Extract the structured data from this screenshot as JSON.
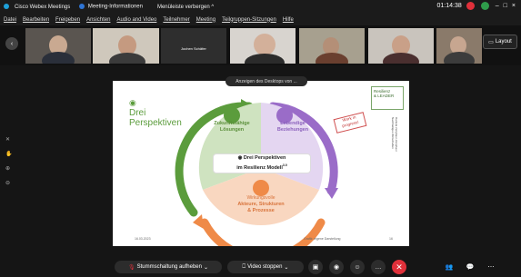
{
  "window": {
    "app_title": "Cisco Webex Meetings",
    "meeting_info": "Meeting-Informationen",
    "hide_menu": "Menüleiste verbergen ^",
    "time": "01:14:38",
    "minimize": "–",
    "close": "×"
  },
  "menubar": {
    "items": [
      "Datei",
      "Bearbeiten",
      "Freigeben",
      "Ansichten",
      "Audio and Video",
      "Teilnehmer",
      "Meeting",
      "Teilgruppen-Sitzungen",
      "Hilfe"
    ]
  },
  "participants": {
    "names": [
      "",
      "",
      "Jochen Schäfer",
      "",
      "",
      "",
      ""
    ],
    "layout_label": "Layout"
  },
  "share_banner": {
    "text": "Anzeigen des Desktops von ..."
  },
  "slide": {
    "title": "Drei\nPerspektiven",
    "logo": "Resilienz\n& LEADER",
    "left": {
      "title": "Zukunftsfähige\nLösungen"
    },
    "right": {
      "title": "Lebendige\nBeziehungen"
    },
    "bottom": {
      "top": "Wirkungsvolle",
      "title": "Akteure, Strukturen\n& Prozesse"
    },
    "center": {
      "line1": "Drei Perspektiven",
      "line2": "im Resilienz Modell",
      "superscript": "3.0"
    },
    "stamp": "Work in\nprogress!",
    "footer_date": "16.03.2023",
    "footer_page": "16",
    "footer_center": "Grafik: eigene Darstellung",
    "vertical_text": "Daniela Zenghaur-Zenghaur\nNachhaltiges Wirtschaften"
  },
  "toolbar": {
    "mute_label": "Stummschaltung aufheben",
    "video_label": "Video stoppen"
  },
  "colors": {
    "green": "#5b9c3c",
    "purple": "#9a6cc8",
    "orange": "#ef8a48",
    "danger": "#e0303a"
  }
}
